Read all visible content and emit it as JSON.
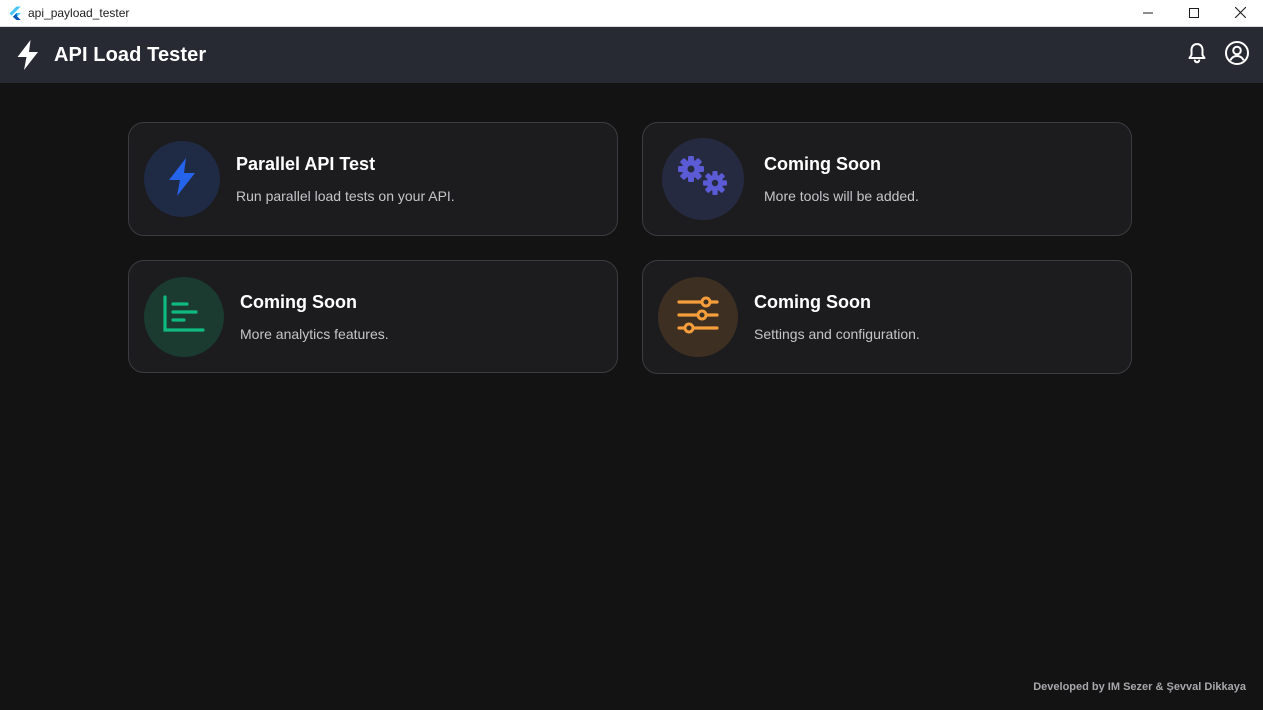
{
  "window": {
    "title": "api_payload_tester",
    "controls": [
      "minimize-icon",
      "maximize-icon",
      "close-icon"
    ]
  },
  "appbar": {
    "title": "API Load Tester",
    "logo_icon": "bolt-icon",
    "actions": [
      "bell-icon",
      "account-icon"
    ]
  },
  "cards": [
    {
      "title": "Parallel API Test",
      "description": "Run parallel load tests on your API.",
      "icon": "bolt-icon",
      "accent": "#2563eb",
      "circle_bg": "#1f2a44"
    },
    {
      "title": "Coming Soon",
      "description": "More tools will be added.",
      "icon": "gears-icon",
      "accent": "#5b5bd6",
      "circle_bg": "#262a40"
    },
    {
      "title": "Coming Soon",
      "description": "More analytics features.",
      "icon": "analytics-icon",
      "accent": "#10b981",
      "circle_bg": "#1b3a30"
    },
    {
      "title": "Coming Soon",
      "description": "Settings and configuration.",
      "icon": "sliders-icon",
      "accent": "#f59e3b",
      "circle_bg": "#3e2f23"
    }
  ],
  "footer": {
    "text": "Developed by IM Sezer & Şevval Dikkaya"
  }
}
